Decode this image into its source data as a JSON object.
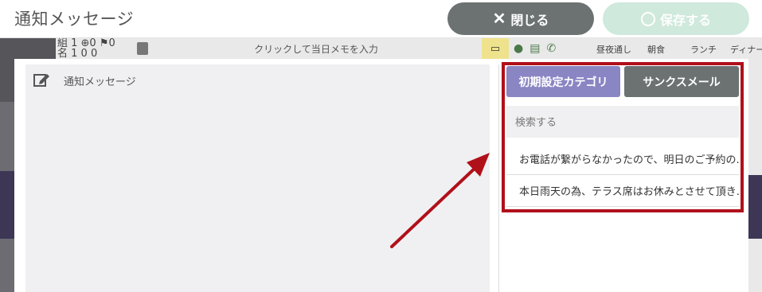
{
  "header": {
    "title": "通知メッセージ",
    "close_label": "閉じる",
    "save_label": "保存する"
  },
  "background_app": {
    "counts_line1": "組 1 ⊕0 ⚑0",
    "counts_line2": "名 1  0  0",
    "memo_placeholder": "クリックして当日メモを入力",
    "toolbar_labels": [
      "昼夜通し",
      "朝食",
      "ランチ",
      "ディナー"
    ]
  },
  "editor": {
    "label": "通知メッセージ"
  },
  "panel": {
    "tabs": [
      "初期設定カテゴリ",
      "サンクスメール"
    ],
    "search_placeholder": "検索する",
    "messages": [
      "お電話が繋がらなかったので、明日のご予約の...",
      "本日雨天の為、テラス席はお休みとさせて頂き..."
    ]
  },
  "annotation": {
    "highlight_color": "#b0101a"
  }
}
